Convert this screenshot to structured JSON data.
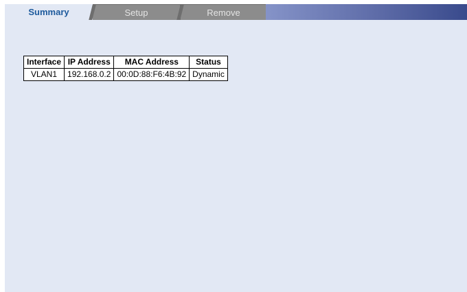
{
  "tabs": {
    "summary": "Summary",
    "setup": "Setup",
    "remove": "Remove"
  },
  "table": {
    "headers": {
      "interface": "Interface",
      "ip_address": "IP Address",
      "mac_address": "MAC Address",
      "status": "Status"
    },
    "rows": [
      {
        "interface": "VLAN1",
        "ip_address": "192.168.0.2",
        "mac_address": "00:0D:88:F6:4B:92",
        "status": "Dynamic"
      }
    ]
  },
  "colors": {
    "content_bg": "#e2e8f4",
    "active_tab_text": "#1d5a9c",
    "inactive_tab_bg": "#8c8c8c",
    "header_gradient_start": "#8593c8",
    "header_gradient_end": "#394a8c"
  }
}
